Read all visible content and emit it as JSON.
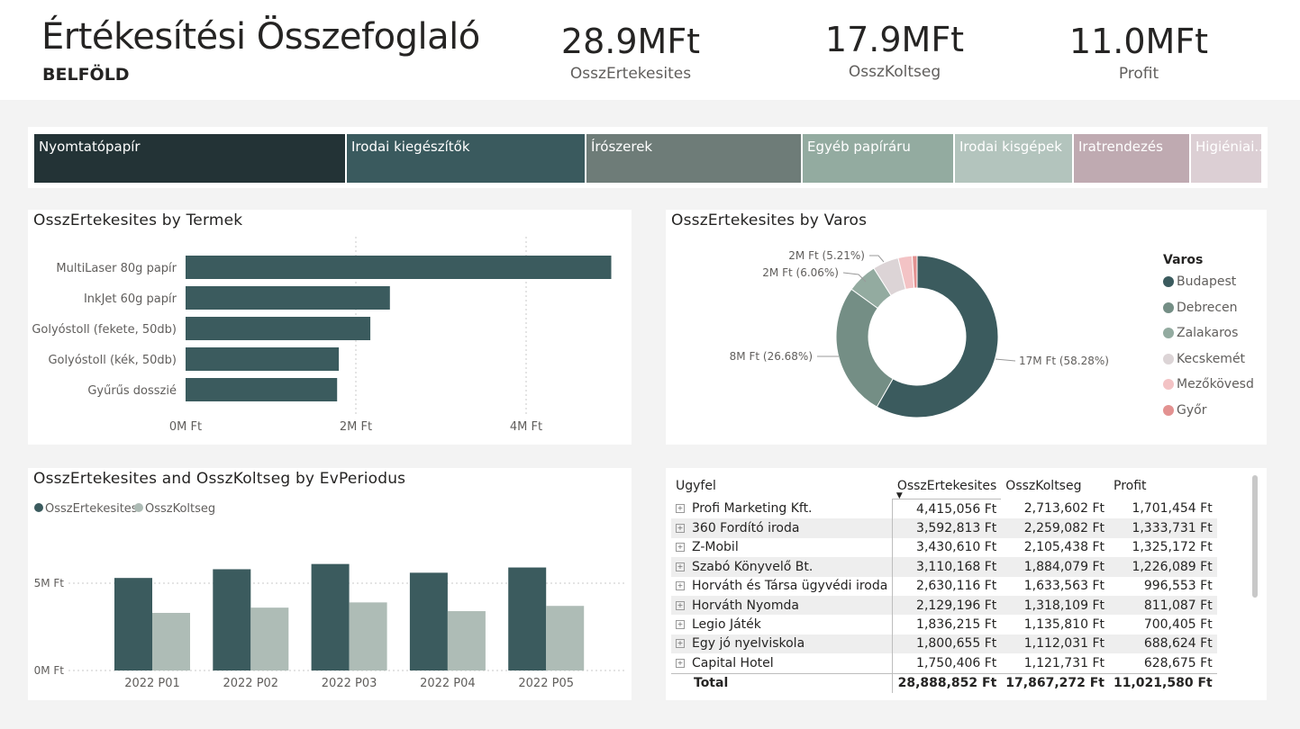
{
  "header": {
    "title": "Értékesítési Összefoglaló",
    "subtitle": "BELFÖLD",
    "kpis": [
      {
        "value": "28.9MFt",
        "label": "OsszErtekesites"
      },
      {
        "value": "17.9MFt",
        "label": "OsszKoltseg"
      },
      {
        "value": "11.0MFt",
        "label": "Profit"
      }
    ]
  },
  "treemap": {
    "tiles": [
      {
        "label": "Nyomtatópapír",
        "color": "#233336"
      },
      {
        "label": "Irodai kiegészítők",
        "color": "#3a5a5e"
      },
      {
        "label": "Írószerek",
        "color": "#6e7c78"
      },
      {
        "label": "Egyéb papíráru",
        "color": "#93aba0"
      },
      {
        "label": "Irodai kisgépek",
        "color": "#b3c4bd"
      },
      {
        "label": "Iratrendezés",
        "color": "#bfaab1"
      },
      {
        "label": "Higiéniai...",
        "color": "#dccfd4"
      }
    ]
  },
  "bar_chart": {
    "title": "OsszErtekesites by Termek",
    "tick_labels": [
      "0M Ft",
      "2M Ft",
      "4M Ft"
    ]
  },
  "donut": {
    "title": "OsszErtekesites by Varos",
    "legend_title": "Varos",
    "labels": [
      "17M Ft (58.28%)",
      "8M Ft (26.68%)",
      "2M Ft (6.06%)",
      "2M Ft (5.21%)"
    ]
  },
  "column_chart": {
    "title": "OsszErtekesites and OsszKoltseg by EvPeriodus",
    "y_tick_labels": [
      "0M Ft",
      "5M Ft"
    ]
  },
  "table": {
    "headers": [
      "Ugyfel",
      "OsszErtekesites",
      "OsszKoltseg",
      "Profit"
    ],
    "rows": [
      [
        "Profi Marketing Kft.",
        "4,415,056 Ft",
        "2,713,602 Ft",
        "1,701,454 Ft"
      ],
      [
        "360 Fordító iroda",
        "3,592,813 Ft",
        "2,259,082 Ft",
        "1,333,731 Ft"
      ],
      [
        "Z-Mobil",
        "3,430,610 Ft",
        "2,105,438 Ft",
        "1,325,172 Ft"
      ],
      [
        "Szabó Könyvelő Bt.",
        "3,110,168 Ft",
        "1,884,079 Ft",
        "1,226,089 Ft"
      ],
      [
        "Horváth és Társa ügyvédi iroda",
        "2,630,116 Ft",
        "1,633,563 Ft",
        "996,553 Ft"
      ],
      [
        "Horváth Nyomda",
        "2,129,196 Ft",
        "1,318,109 Ft",
        "811,087 Ft"
      ],
      [
        "Legio Játék",
        "1,836,215 Ft",
        "1,135,810 Ft",
        "700,405 Ft"
      ],
      [
        "Egy jó nyelviskola",
        "1,800,655 Ft",
        "1,112,031 Ft",
        "688,624 Ft"
      ],
      [
        "Capital Hotel",
        "1,750,406 Ft",
        "1,121,731 Ft",
        "628,675 Ft"
      ]
    ],
    "total": [
      "Total",
      "28,888,852 Ft",
      "17,867,272 Ft",
      "11,021,580 Ft"
    ]
  },
  "chart_data": [
    {
      "type": "bar",
      "title": "OsszErtekesites by Termek",
      "orientation": "horizontal",
      "categories": [
        "MultiLaser 80g papír",
        "InkJet 60g papír",
        "Golyóstoll (fekete, 50db)",
        "Golyóstoll (kék, 50db)",
        "Gyűrűs dosszié"
      ],
      "values": [
        5.0,
        2.4,
        2.17,
        1.8,
        1.78
      ],
      "unit": "M Ft",
      "xlim": [
        0,
        5.5
      ],
      "color": "#3b5b5e"
    },
    {
      "type": "pie",
      "variant": "donut",
      "title": "OsszErtekesites by Varos",
      "legend_title": "Varos",
      "legend_position": "right",
      "categories": [
        "Budapest",
        "Debrecen",
        "Zalakaros",
        "Kecskemét",
        "Mezőkövesd",
        "Győr"
      ],
      "values": [
        58.28,
        26.68,
        6.06,
        5.21,
        2.8,
        0.97
      ],
      "colors": [
        "#3b5b5e",
        "#748e85",
        "#93aba0",
        "#dcd4d6",
        "#f3c3c5",
        "#e39291"
      ]
    },
    {
      "type": "bar",
      "title": "OsszErtekesites and OsszKoltseg by EvPeriodus",
      "categories": [
        "2022 P01",
        "2022 P02",
        "2022 P03",
        "2022 P04",
        "2022 P05"
      ],
      "series": [
        {
          "name": "OsszErtekesites",
          "values": [
            5.3,
            5.8,
            6.1,
            5.6,
            5.9
          ],
          "color": "#3b5b5e"
        },
        {
          "name": "OsszKoltseg",
          "values": [
            3.3,
            3.6,
            3.9,
            3.4,
            3.7
          ],
          "color": "#aebcb6"
        }
      ],
      "ylim": [
        0,
        7
      ],
      "unit": "M Ft",
      "legend_position": "top-left"
    }
  ]
}
